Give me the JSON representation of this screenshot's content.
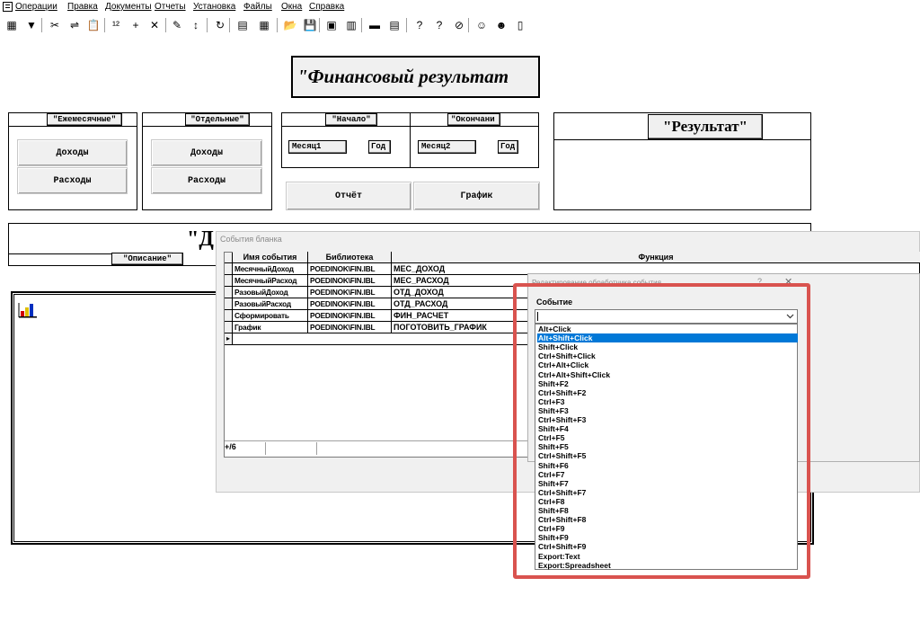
{
  "menu": [
    "Операции",
    "Правка",
    "Документы",
    "Отчеты",
    "Установка",
    "Файлы",
    "Окна",
    "Справка"
  ],
  "toolbar": {
    "icons": [
      "grid-icon",
      "filter-icon",
      "scissors-icon",
      "paste-icon",
      "clipboard-icon",
      "abc-icon",
      "add-icon",
      "delete-icon",
      "pencil-icon",
      "sort-icon",
      "refresh-icon",
      "pdf-icon",
      "calculator-icon",
      "open-folder-icon",
      "save-icon",
      "window-icon",
      "layout-icon",
      "print-icon",
      "print-preview-icon",
      "help-icon",
      "context-help-icon",
      "compass-icon",
      "users-icon",
      "user-icon",
      "book-icon"
    ],
    "glyphs": [
      "▦",
      "▼",
      "✂",
      "⇌",
      "📋",
      "¹²",
      "+",
      "✕",
      "✎",
      "↕",
      "↻",
      "▤",
      "▦",
      "📂",
      "💾",
      "▣",
      "▥",
      "▬",
      "▤",
      "?",
      "?",
      "⊘",
      "☺",
      "☻",
      "▯"
    ]
  },
  "form": {
    "title": "\"Финансовый результат",
    "monthly_label": "\"Ежемесячные\"",
    "separate_label": "\"Отдельные\"",
    "start_label": "\"Начало\"",
    "end_label": "\"Окончани",
    "income_btn": "Доходы",
    "expense_btn": "Расходы",
    "income_btn2": "Доходы",
    "expense_btn2": "Расходы",
    "month1": "Месяц1",
    "year1": "Год",
    "month2": "Месяц2",
    "year2": "Год",
    "report_btn": "Отчёт",
    "chart_btn": "График",
    "result_label": "\"Результат\"",
    "description_label": "\"Описание\"",
    "d_label": "\"Д"
  },
  "events_window": {
    "title": "События бланка",
    "columns": [
      "Имя события",
      "Библиотека",
      "Функция"
    ],
    "rows": [
      {
        "event": "МесячныйДоход",
        "library": "POEDINOK\\FIN.IBL",
        "function": "МЕС_ДОХОД"
      },
      {
        "event": "МесячныйРасход",
        "library": "POEDINOK\\FIN.IBL",
        "function": "МЕС_РАСХОД"
      },
      {
        "event": "РазовыйДоход",
        "library": "POEDINOK\\FIN.IBL",
        "function": "ОТД_ДОХОД"
      },
      {
        "event": "РазовыйРасход",
        "library": "POEDINOK\\FIN.IBL",
        "function": "ОТД_РАСХОД"
      },
      {
        "event": "Сформировать",
        "library": "POEDINOK\\FIN.IBL",
        "function": "ФИН_РАСЧЕТ"
      },
      {
        "event": "График",
        "library": "POEDINOK\\FIN.IBL",
        "function": "ПОГОТОВИТЬ_ГРАФИК"
      }
    ],
    "status": "+/6"
  },
  "handler_dialog": {
    "title": "Редактирование обработчика события",
    "event_label": "Событие",
    "combo_value": "",
    "options": [
      "Alt+Click",
      "Alt+Shift+Click",
      "Shift+Click",
      "Ctrl+Shift+Click",
      "Ctrl+Alt+Click",
      "Ctrl+Alt+Shift+Click",
      "Shift+F2",
      "Ctrl+Shift+F2",
      "Ctrl+F3",
      "Shift+F3",
      "Ctrl+Shift+F3",
      "Shift+F4",
      "Ctrl+F5",
      "Shift+F5",
      "Ctrl+Shift+F5",
      "Shift+F6",
      "Ctrl+F7",
      "Shift+F7",
      "Ctrl+Shift+F7",
      "Ctrl+F8",
      "Shift+F8",
      "Ctrl+Shift+F8",
      "Ctrl+F9",
      "Shift+F9",
      "Ctrl+Shift+F9",
      "Export:Text",
      "Export:Spreadsheet"
    ],
    "selected": "Alt+Shift+Click"
  },
  "colors": {
    "highlight": "#d9534f",
    "selection": "#0078d7"
  }
}
